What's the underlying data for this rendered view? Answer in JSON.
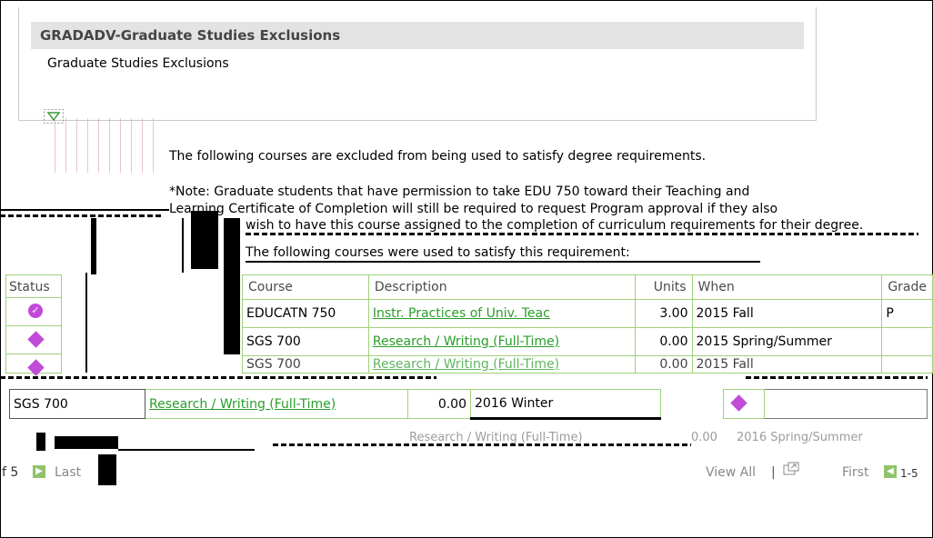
{
  "header": {
    "title": "GRADADV-Graduate Studies Exclusions",
    "subtitle": "Graduate Studies Exclusions"
  },
  "section": {
    "intro": "The following courses are excluded from being used to satisfy degree requirements.",
    "note_line1": "*Note: Graduate students that have permission to take EDU 750 toward their Teaching and",
    "note_line2": "Learning Certificate of Completion will still be required to request Program approval if they also",
    "note_line3": "wish to have this course assigned to the completion of curriculum requirements for their degree.",
    "used_line": "The following courses were used to satisfy this requirement:"
  },
  "table": {
    "columns": [
      "Course",
      "Description",
      "Units",
      "When",
      "Grade"
    ],
    "status_header": "Status",
    "rows": [
      {
        "course": "EDUCATN 750",
        "description": "Instr. Practices of Univ. Teac",
        "units": "3.00",
        "when": "2015 Fall",
        "grade": "P",
        "status": "taken"
      },
      {
        "course": "SGS 700",
        "description": "Research / Writing (Full-Time)",
        "units": "0.00",
        "when": "2015 Spring/Summer",
        "grade": "",
        "status": "in-progress"
      },
      {
        "course": "SGS 700",
        "description": "Research / Writing (Full-Time)",
        "units": "0.00",
        "when": "2015 Fall",
        "grade": "",
        "status": "in-progress"
      },
      {
        "course": "SGS 700",
        "description": "Research / Writing (Full-Time)",
        "units": "0.00",
        "when": "2016 Winter",
        "grade": "",
        "status": "in-progress"
      },
      {
        "course": "SGS 700",
        "description": "Research / Writing (Full-Time)",
        "units": "0.00",
        "when": "2016 Spring/Summer",
        "grade": "",
        "status": "in-progress"
      }
    ]
  },
  "nav": {
    "of_label": "f 5",
    "last_label": "Last",
    "view_all": "View All",
    "first_label": "First",
    "range": "1-5"
  },
  "colors": {
    "accent_green": "#2a9d2a",
    "grid_border": "#9fd27a",
    "status_purple": "#c04bd8",
    "header_bg": "#e3e3e3"
  }
}
